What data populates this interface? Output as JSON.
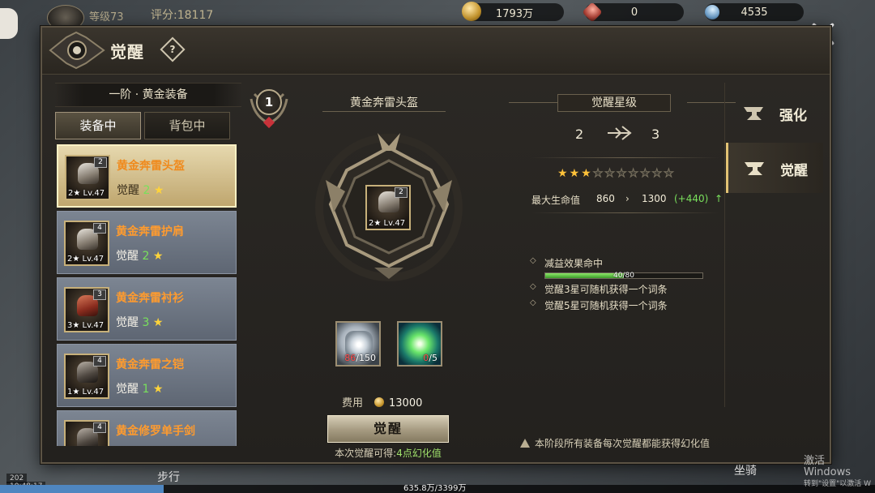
{
  "hud": {
    "level": "等级73",
    "score": "评分:18117",
    "gold": "1793万",
    "ruby": "0",
    "gem": "4535",
    "time_a": "202",
    "time": "10:48:17",
    "walk": "步行",
    "mount": "坐骑",
    "exp": "635.8万/3399万",
    "exp_fraction": 0.187
  },
  "watermark": {
    "line1": "激活 Windows",
    "line2": "转到\"设置\"以激活 W"
  },
  "panel": {
    "title": "觉醒",
    "help": "?"
  },
  "left": {
    "tier_title": "一阶 · 黄金装备",
    "tabs": [
      {
        "label": "装备中",
        "active": true
      },
      {
        "label": "背包中",
        "active": false
      }
    ],
    "items": [
      {
        "name": "黄金奔雷头盔",
        "awaken_label": "觉醒",
        "stars": "2",
        "star_glyph": "★",
        "lv": "2★ Lv.47",
        "badge": "2",
        "selected": true
      },
      {
        "name": "黄金奔雷护肩",
        "awaken_label": "觉醒",
        "stars": "2",
        "star_glyph": "★",
        "lv": "2★ Lv.47",
        "badge": "4",
        "selected": false
      },
      {
        "name": "黄金奔雷衬衫",
        "awaken_label": "觉醒",
        "stars": "3",
        "star_glyph": "★",
        "lv": "3★ Lv.47",
        "badge": "3",
        "selected": false
      },
      {
        "name": "黄金奔雷之铠",
        "awaken_label": "觉醒",
        "stars": "1",
        "star_glyph": "★",
        "lv": "1★ Lv.47",
        "badge": "4",
        "selected": false
      },
      {
        "name": "黄金修罗单手剑",
        "awaken_label": "",
        "stars": "",
        "star_glyph": "",
        "lv": "",
        "badge": "4",
        "selected": false
      }
    ]
  },
  "center": {
    "tier_number": "1",
    "equip_name": "黄金奔雷头盔",
    "equip_lv": "2★ Lv.47",
    "equip_badge": "2",
    "materials": [
      {
        "name": "ore-material",
        "have": "86",
        "need": "/150"
      },
      {
        "name": "crystal-material",
        "have": "0",
        "need": "/5"
      }
    ],
    "cost_label": "费用",
    "cost_value": "13000",
    "awaken_button": "觉醒",
    "gain_prefix": "本次觉醒可得:",
    "gain_value": "4点幻化值"
  },
  "right": {
    "star_title": "觉醒星级",
    "level_from": "2",
    "level_to": "3",
    "stars_on": 3,
    "stars_total": 10,
    "stat": {
      "name": "最大生命值",
      "from": "860",
      "arrow": "›",
      "to": "1300",
      "diff": "(+440)",
      "up": "↑"
    },
    "effects": [
      {
        "text": "减益效果命中",
        "progress": "40/80",
        "fraction": 0.5
      },
      {
        "text": "觉醒3星可随机获得一个词条"
      },
      {
        "text": "觉醒5星可随机获得一个词条"
      }
    ],
    "footer_note": "本阶段所有装备每次觉醒都能获得幻化值"
  },
  "side_tabs": [
    {
      "label": "强化",
      "active": false
    },
    {
      "label": "觉醒",
      "active": true
    }
  ],
  "colors": {
    "accent_gold": "#e2c274",
    "item_orange": "#ff9b2e",
    "positive_green": "#79e05c",
    "star_gold": "#ffc23a"
  }
}
